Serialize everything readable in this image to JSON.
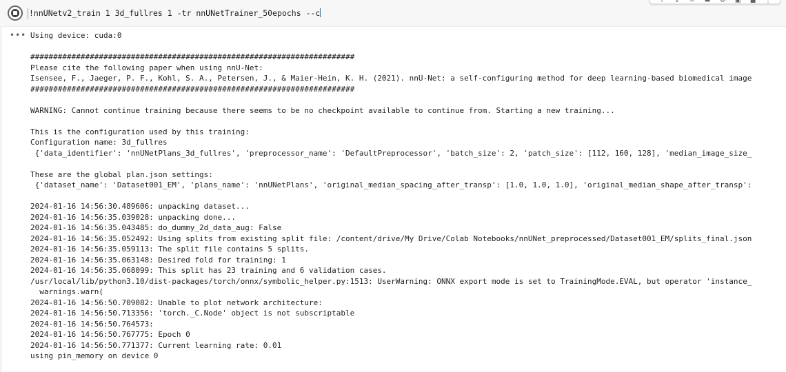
{
  "cell": {
    "command": "!nnUNetv2_train 1 3d_fullres 1 -tr nnUNetTrainer_50epochs --c",
    "output_gutter": "•••"
  },
  "toolbar": {
    "icons": [
      "arrow-up-icon",
      "arrow-down-icon",
      "link-icon",
      "comment-icon",
      "gear-icon",
      "mirror-icon",
      "delete-icon",
      "more-icon"
    ]
  },
  "output": {
    "lines": [
      "Using device: cuda:0",
      "",
      "#######################################################################",
      "Please cite the following paper when using nnU-Net:",
      "Isensee, F., Jaeger, P. F., Kohl, S. A., Petersen, J., & Maier-Hein, K. H. (2021). nnU-Net: a self-configuring method for deep learning-based biomedical image",
      "#######################################################################",
      "",
      "WARNING: Cannot continue training because there seems to be no checkpoint available to continue from. Starting a new training...",
      "",
      "This is the configuration used by this training:",
      "Configuration name: 3d_fullres",
      " {'data_identifier': 'nnUNetPlans_3d_fullres', 'preprocessor_name': 'DefaultPreprocessor', 'batch_size': 2, 'patch_size': [112, 160, 128], 'median_image_size_",
      "",
      "These are the global plan.json settings:",
      " {'dataset_name': 'Dataset001_EM', 'plans_name': 'nnUNetPlans', 'original_median_spacing_after_transp': [1.0, 1.0, 1.0], 'original_median_shape_after_transp':",
      "",
      "2024-01-16 14:56:30.489606: unpacking dataset...",
      "2024-01-16 14:56:35.039028: unpacking done...",
      "2024-01-16 14:56:35.043485: do_dummy_2d_data_aug: False",
      "2024-01-16 14:56:35.052492: Using splits from existing split file: /content/drive/My Drive/Colab Notebooks/nnUNet_preprocessed/Dataset001_EM/splits_final.json",
      "2024-01-16 14:56:35.059113: The split file contains 5 splits.",
      "2024-01-16 14:56:35.063148: Desired fold for training: 1",
      "2024-01-16 14:56:35.068099: This split has 23 training and 6 validation cases.",
      "/usr/local/lib/python3.10/dist-packages/torch/onnx/symbolic_helper.py:1513: UserWarning: ONNX export mode is set to TrainingMode.EVAL, but operator 'instance_",
      "  warnings.warn(",
      "2024-01-16 14:56:50.709082: Unable to plot network architecture:",
      "2024-01-16 14:56:50.713356: 'torch._C.Node' object is not subscriptable",
      "2024-01-16 14:56:50.764573:",
      "2024-01-16 14:56:50.767775: Epoch 0",
      "2024-01-16 14:56:50.771377: Current learning rate: 0.01",
      "using pin_memory on device 0"
    ]
  }
}
